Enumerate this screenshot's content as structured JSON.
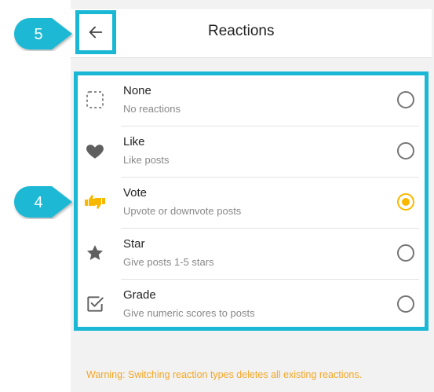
{
  "header": {
    "title": "Reactions",
    "back_icon": "arrow-left-icon"
  },
  "options": [
    {
      "id": "none",
      "label": "None",
      "description": "No reactions",
      "icon": "dashed-square-icon",
      "selected": false
    },
    {
      "id": "like",
      "label": "Like",
      "description": "Like posts",
      "icon": "heart-icon",
      "selected": false
    },
    {
      "id": "vote",
      "label": "Vote",
      "description": "Upvote or downvote posts",
      "icon": "thumbs-up-down-icon",
      "selected": true
    },
    {
      "id": "star",
      "label": "Star",
      "description": "Give posts 1-5 stars",
      "icon": "star-icon",
      "selected": false
    },
    {
      "id": "grade",
      "label": "Grade",
      "description": "Give numeric scores to posts",
      "icon": "checkbox-check-icon",
      "selected": false
    }
  ],
  "warning": "Warning: Switching reaction types deletes all existing reactions.",
  "callouts": [
    {
      "number": "5",
      "target": "back-button"
    },
    {
      "number": "4",
      "target": "reaction-options-list"
    }
  ],
  "colors": {
    "accent": "#f9b800",
    "callout": "#1ab8d4",
    "warning": "#f5a623",
    "icon": "#666666"
  }
}
